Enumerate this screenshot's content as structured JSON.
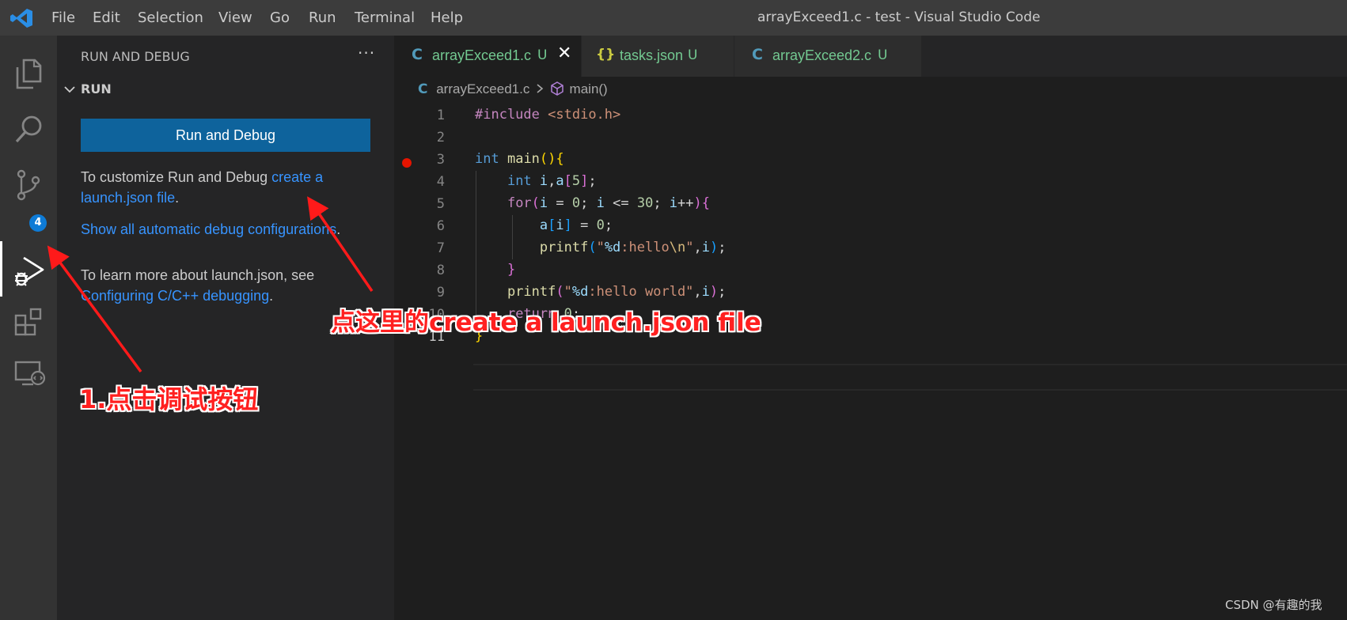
{
  "titlebar": {
    "menu": [
      "File",
      "Edit",
      "Selection",
      "View",
      "Go",
      "Run",
      "Terminal",
      "Help"
    ],
    "window_title": "arrayExceed1.c - test - Visual Studio Code"
  },
  "activitybar": {
    "items": [
      "explorer-icon",
      "search-icon",
      "source-control-icon",
      "run-debug-icon",
      "extensions-icon",
      "remote-explorer-icon"
    ],
    "source_control_badge": "4",
    "active": "run-debug-icon"
  },
  "sidebar": {
    "title": "RUN AND DEBUG",
    "more": "···",
    "section": "RUN",
    "run_button": "Run and Debug",
    "customize_text": "To customize Run and Debug ",
    "customize_link": "create a launch.json file",
    "customize_end": ".",
    "show_all_link": "Show all automatic debug configurations",
    "show_all_end": ".",
    "learn_text": "To learn more about launch.json, see ",
    "learn_link": "Configuring C/C++ debugging",
    "learn_end": "."
  },
  "tabs": [
    {
      "icon": "C",
      "label": "arrayExceed1.c",
      "status": "U",
      "active": true
    },
    {
      "icon": "{}",
      "label": "tasks.json",
      "status": "U",
      "active": false
    },
    {
      "icon": "C",
      "label": "arrayExceed2.c",
      "status": "U",
      "active": false
    }
  ],
  "breadcrumb": {
    "file_icon": "C",
    "file": "arrayExceed1.c",
    "symbol": "main()"
  },
  "code": {
    "line_numbers": [
      "1",
      "2",
      "3",
      "4",
      "5",
      "6",
      "7",
      "8",
      "9",
      "10",
      "11"
    ],
    "lines": [
      "#include <stdio.h>",
      "",
      "int main(){",
      "    int i,a[5];",
      "    for(i = 0; i <= 30; i++){",
      "        a[i] = 0;",
      "        printf(\"%d:hello\\n\",i);",
      "    }",
      "    printf(\"%d:hello world\",i);",
      "    return 0;",
      "}"
    ],
    "breakpoint_line": "3",
    "current_line": "11"
  },
  "annotations": {
    "link_hint": "点这里的create a launch.json file",
    "step1": "1.点击调试按钮"
  },
  "watermark": "CSDN @有趣的我",
  "colors": {
    "accent_button": "#0e639c",
    "link": "#3794ff",
    "annotation": "#ff2020",
    "untracked": "#73c991",
    "breakpoint": "#e51400"
  }
}
